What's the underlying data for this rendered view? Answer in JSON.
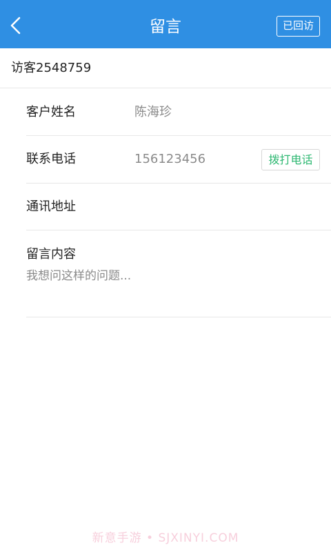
{
  "header": {
    "title": "留言",
    "visited_label": "已回访"
  },
  "visitor": {
    "name": "访客2548759"
  },
  "form": {
    "name_label": "客户姓名",
    "name_value": "陈海珍",
    "phone_label": "联系电话",
    "phone_value": "156123456",
    "call_label": "拨打电话",
    "address_label": "通讯地址",
    "address_value": "",
    "message_label": "留言内容",
    "message_value": "我想问这样的问题..."
  },
  "watermark": "新意手游 • SJXINYI.COM",
  "colors": {
    "header": "#2f8fe3",
    "call_button_text": "#2eb872"
  }
}
